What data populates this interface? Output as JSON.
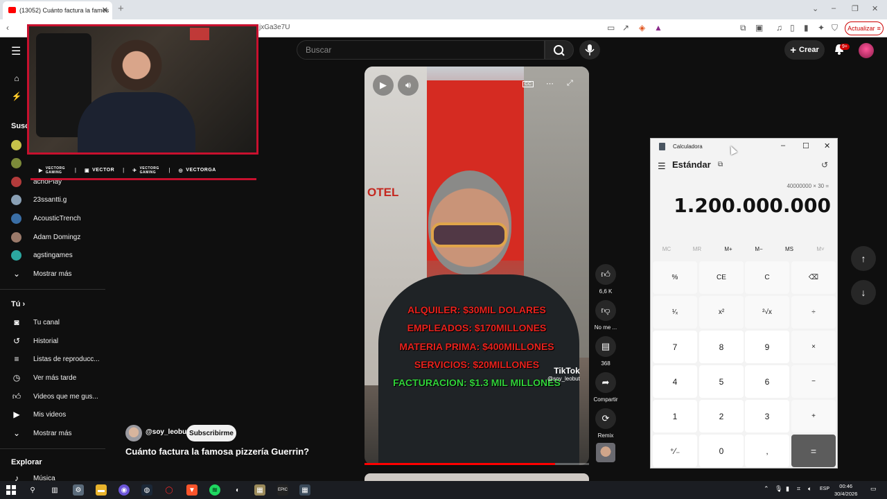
{
  "browser": {
    "tab_title": "(13052) Cuánto factura la famos",
    "url": "jxGa3e7U",
    "update_label": "Actualizar"
  },
  "youtube": {
    "search_placeholder": "Buscar",
    "create_label": "Crear",
    "notif_badge": "9+"
  },
  "sidebar": {
    "subs_heading": "Susc",
    "subs": [
      {
        "name": "",
        "color": "#c6c24a"
      },
      {
        "name": "",
        "color": "#7c8a3a"
      },
      {
        "name": "achoPlay",
        "color": "#b33b3b"
      },
      {
        "name": "23ssantti.g",
        "color": "#8aa0b5"
      },
      {
        "name": "AcousticTrench",
        "color": "#3a6ea5"
      },
      {
        "name": "Adam Domingz",
        "color": "#9b7a6a"
      },
      {
        "name": "agstingames",
        "color": "#2ca7a0"
      }
    ],
    "show_more": "Mostrar más",
    "you_heading": "Tú",
    "you_items": [
      {
        "label": "Tu canal",
        "icon": "channel-icon"
      },
      {
        "label": "Historial",
        "icon": "history-icon"
      },
      {
        "label": "Listas de reproducc...",
        "icon": "playlist-icon"
      },
      {
        "label": "Ver más tarde",
        "icon": "clock-icon"
      },
      {
        "label": "Videos que me gus...",
        "icon": "like-icon"
      },
      {
        "label": "Mis videos",
        "icon": "video-icon"
      },
      {
        "label": "Mostrar más",
        "icon": "chevron-down-icon"
      }
    ],
    "explore_heading": "Explorar",
    "explore_items": [
      {
        "label": "Música",
        "icon": "music-icon"
      }
    ]
  },
  "stream_overlay": {
    "socials": [
      {
        "icon": "youtube-icon",
        "text": "VECTORG GAMING"
      },
      {
        "icon": "twitch-icon",
        "text": "VECTOR"
      },
      {
        "icon": "twitter-icon",
        "text": "VECTORG GAMING"
      },
      {
        "icon": "instagram-icon",
        "text": "VECTORGA"
      }
    ]
  },
  "short": {
    "captions": [
      "ALQUILER: $30MIL DOLARES",
      "EMPLEADOS: $170MILLONES",
      "MATERIA PRIMA: $400MILLONES",
      "SERVICIOS: $20MILLONES",
      "FACTURACION: $1.3 MIL MILLONES"
    ],
    "tiktok_label": "TikTok",
    "tiktok_handle": "@soy_leobut",
    "sign_text": "OTEL",
    "progress": 0.85,
    "channel": "@soy_leobut",
    "subscribe": "Subscribirme",
    "title": "Cuánto factura la famosa pizzería Guerrin?"
  },
  "actions": {
    "likes": "6,6 K",
    "dislike": "No me ...",
    "comments": "368",
    "share": "Compartir",
    "remix": "Remix"
  },
  "calculator": {
    "title": "Calculadora",
    "mode": "Estándar",
    "expression": "40000000 × 30 =",
    "result": "1.200.000.000",
    "memory": [
      {
        "label": "MC",
        "enabled": false
      },
      {
        "label": "MR",
        "enabled": false
      },
      {
        "label": "M+",
        "enabled": true
      },
      {
        "label": "M−",
        "enabled": true
      },
      {
        "label": "MS",
        "enabled": true
      },
      {
        "label": "M˅",
        "enabled": false
      }
    ],
    "keys": [
      [
        "%",
        "CE",
        "C",
        "⌫"
      ],
      [
        "¹⁄ₓ",
        "x²",
        "²√x",
        "÷"
      ],
      [
        "7",
        "8",
        "9",
        "×"
      ],
      [
        "4",
        "5",
        "6",
        "−"
      ],
      [
        "1",
        "2",
        "3",
        "+"
      ],
      [
        "⁺⁄₋",
        "0",
        ",",
        "="
      ]
    ]
  },
  "taskbar": {
    "lang": "ESP",
    "time": "00:46",
    "date": "30/4/2026"
  }
}
